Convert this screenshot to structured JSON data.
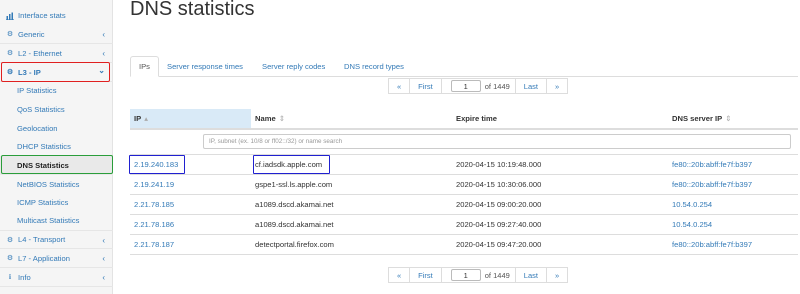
{
  "sidebar": {
    "items": [
      {
        "label": "Interface stats",
        "icon": "bar-chart-icon",
        "chevron": ""
      },
      {
        "label": "Generic",
        "icon": "gear-icon",
        "chevron": "‹"
      },
      {
        "label": "L2 - Ethernet",
        "icon": "gear-icon",
        "chevron": "‹"
      },
      {
        "label": "L3 - IP",
        "icon": "gear-icon",
        "chevron": "⌄"
      },
      {
        "label": "L4 - Transport",
        "icon": "gear-icon",
        "chevron": "‹"
      },
      {
        "label": "L7 - Application",
        "icon": "gear-icon",
        "chevron": "‹"
      },
      {
        "label": "Info",
        "icon": "info-icon",
        "chevron": "‹"
      }
    ],
    "subitems": [
      "IP Statistics",
      "QoS Statistics",
      "Geolocation",
      "DHCP Statistics",
      "DNS Statistics",
      "NetBIOS Statistics",
      "ICMP Statistics",
      "Multicast Statistics"
    ]
  },
  "page": {
    "title": "DNS statistics"
  },
  "tabs": [
    "IPs",
    "Server response times",
    "Server reply codes",
    "DNS record types"
  ],
  "pager": {
    "prev": "«",
    "first": "First",
    "page": "1",
    "of": "of 1449",
    "last": "Last",
    "next": "»"
  },
  "table": {
    "headers": [
      "IP",
      "Name",
      "Expire time",
      "DNS server IP"
    ],
    "filter_placeholder": "IP, subnet (ex. 10/8 or ff02::/32) or name search",
    "rows": [
      [
        "2.19.240.183",
        "cf.iadsdk.apple.com",
        "2020-04-15 10:19:48.000",
        "fe80::20b:abff:fe7f:b397"
      ],
      [
        "2.19.241.19",
        "gspe1-ssl.ls.apple.com",
        "2020-04-15 10:30:06.000",
        "fe80::20b:abff:fe7f:b397"
      ],
      [
        "2.21.78.185",
        "a1089.dscd.akamai.net",
        "2020-04-15 09:00:20.000",
        "10.54.0.254"
      ],
      [
        "2.21.78.186",
        "a1089.dscd.akamai.net",
        "2020-04-15 09:27:40.000",
        "10.54.0.254"
      ],
      [
        "2.21.78.187",
        "detectportal.firefox.com",
        "2020-04-15 09:47:20.000",
        "fe80::20b:abff:fe7f:b397"
      ]
    ]
  },
  "colors": {
    "link": "#337ab7",
    "highlight_red": "#e02020",
    "highlight_green": "#2a9d3a",
    "highlight_blue": "#2020d0"
  }
}
